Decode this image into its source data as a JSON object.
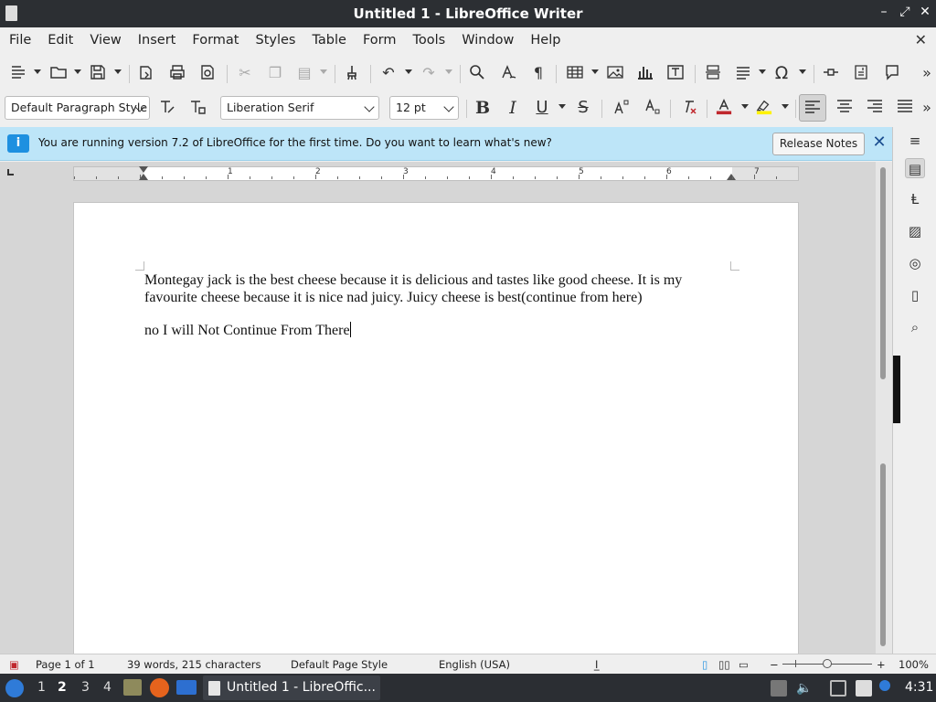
{
  "window": {
    "title": "Untitled 1 - LibreOffice Writer",
    "minimize": "–",
    "maximize": "⤢",
    "close": "✕"
  },
  "menubar": {
    "items": [
      "File",
      "Edit",
      "View",
      "Insert",
      "Format",
      "Styles",
      "Table",
      "Form",
      "Tools",
      "Window",
      "Help"
    ],
    "close": "✕"
  },
  "formatting": {
    "paragraph_style": "Default Paragraph Style",
    "font_name": "Liberation Serif",
    "font_size": "12 pt",
    "bold": "B",
    "italic": "I",
    "underline": "U",
    "strikethrough": "S",
    "font_color": "#c0272d",
    "highlight_color": "#fff200"
  },
  "infobar": {
    "message": "You are running version 7.2 of LibreOffice for the first time. Do you want to learn what's new?",
    "button": "Release Notes",
    "close": "✕"
  },
  "ruler": {
    "numbers": [
      "1",
      "2",
      "3",
      "4",
      "5",
      "6",
      "7"
    ]
  },
  "document": {
    "paragraphs": [
      "Montegay jack is the best cheese because it is delicious and tastes like good cheese. It is my favourite cheese because it is nice nad juicy. Juicy cheese is best(continue from here)",
      "no I will Not Continue From There"
    ]
  },
  "statusbar": {
    "page": "Page 1 of 1",
    "words": "39 words, 215 characters",
    "page_style": "Default Page Style",
    "language": "English (USA)",
    "zoom": "100%",
    "zoom_minus": "−",
    "zoom_plus": "+"
  },
  "taskbar": {
    "workspaces": [
      "1",
      "2",
      "3",
      "4"
    ],
    "active_workspace": "2",
    "task": "Untitled 1 - LibreOffic...",
    "clock": "4:31"
  }
}
